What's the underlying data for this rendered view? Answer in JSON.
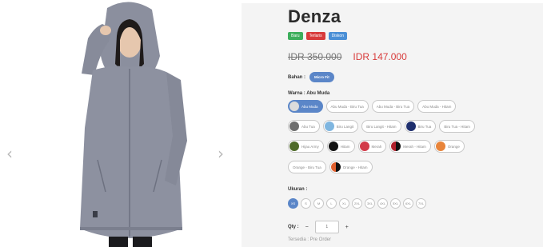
{
  "gallery": {
    "prev_icon": "‹",
    "next_icon": "›",
    "product_image_alt": "Model wearing grey hooded jacket"
  },
  "product": {
    "title": "Denza",
    "tags": [
      {
        "label": "Baru",
        "color": "#3dae5c"
      },
      {
        "label": "Terlaris",
        "color": "#d83b3b"
      },
      {
        "label": "Diskon",
        "color": "#4a8fd6"
      }
    ],
    "old_price": "IDR 350.000",
    "new_price": "IDR 147.000",
    "bahan_label": "Bahan :",
    "bahan_value": "Micro Fit",
    "warna_label": "Warna : Abu Muda",
    "colors_row1": [
      {
        "label": "Abu Muda",
        "selected": true,
        "swatch": "#dcdcdc"
      },
      {
        "label": "Abu Muda - Biru Tua",
        "selected": false,
        "swatch": ""
      },
      {
        "label": "Abu Muda - Biru Tua",
        "selected": false,
        "swatch": ""
      },
      {
        "label": "Abu Muda - Hitam",
        "selected": false,
        "swatch": ""
      }
    ],
    "colors_row2": [
      {
        "label": "Abu Tua",
        "swatch": "#6e6e6e"
      },
      {
        "label": "Biru Langit",
        "swatch": "#7fb6e0"
      },
      {
        "label": "Biru Langit - Hitam",
        "swatch": ""
      },
      {
        "label": "Biru Tua",
        "swatch": "#1e2f6e"
      },
      {
        "label": "Biru Tua - Hitam",
        "swatch": ""
      }
    ],
    "colors_row3": [
      {
        "label": "Hijau Army",
        "swatch": "#4f6b2a"
      },
      {
        "label": "Hitam",
        "swatch": "#111111"
      },
      {
        "label": "Merah",
        "swatch": "#d23a48"
      },
      {
        "label": "Merah - Hitam",
        "swatch": "#b0202c"
      },
      {
        "label": "Orange",
        "swatch": "#e8843a"
      }
    ],
    "colors_row4": [
      {
        "label": "Orange - Biru Tua",
        "swatch": ""
      },
      {
        "label": "Orange - Hitam",
        "swatch": "#e0602f"
      }
    ],
    "ukuran_label": "Ukuran :",
    "sizes": [
      "XS",
      "S",
      "M",
      "L",
      "XL",
      "2XL",
      "3XL",
      "4XL",
      "5XL",
      "6XL",
      "7XL"
    ],
    "selected_size": "XS",
    "qty_label": "Qty :",
    "qty_minus": "−",
    "qty_value": "1",
    "qty_plus": "+",
    "availability": "Tersedia : Pre Order"
  }
}
